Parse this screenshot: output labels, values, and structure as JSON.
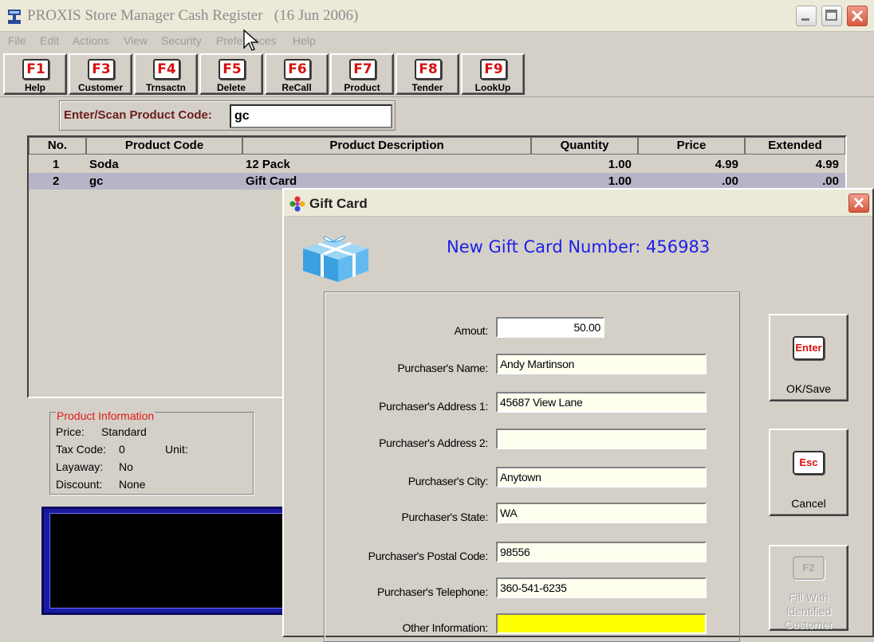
{
  "window": {
    "title": "PROXIS Store Manager Cash Register",
    "date": "(16 Jun 2006)",
    "app_icon": "register-icon",
    "buttons": [
      "minimize-icon",
      "maximize-icon",
      "close-icon"
    ]
  },
  "menu": [
    "File",
    "Edit",
    "Actions",
    "View",
    "Security",
    "Preferences",
    "Help"
  ],
  "toolbar": [
    {
      "key": "F1",
      "label": "Help"
    },
    {
      "key": "F3",
      "label": "Customer"
    },
    {
      "key": "F4",
      "label": "Trnsactn"
    },
    {
      "key": "F5",
      "label": "Delete"
    },
    {
      "key": "F6",
      "label": "ReCall"
    },
    {
      "key": "F7",
      "label": "Product"
    },
    {
      "key": "F8",
      "label": "Tender"
    },
    {
      "key": "F9",
      "label": "LookUp"
    }
  ],
  "scan": {
    "label": "Enter/Scan Product Code:",
    "value": "gc"
  },
  "grid": {
    "columns": [
      "No.",
      "Product Code",
      "Product Description",
      "Quantity",
      "Price",
      "Extended"
    ],
    "rows": [
      [
        "1",
        "Soda",
        "12 Pack",
        "1.00",
        "4.99",
        "4.99"
      ],
      [
        "2",
        "gc",
        "Gift Card",
        "1.00",
        ".00",
        ".00"
      ]
    ],
    "selected_row": 1
  },
  "product_info": {
    "legend": "Product Information",
    "price_label": "Price:",
    "price_value": "Standard",
    "tax_label": "Tax Code:",
    "tax_value": "0",
    "unit_label": "Unit:",
    "unit_value": "",
    "layaway_label": "Layaway:",
    "layaway_value": "No",
    "discount_label": "Discount:",
    "discount_value": "None"
  },
  "dialog": {
    "title": "Gift Card",
    "heading": "New Gift Card Number: 456983",
    "fields": [
      {
        "label": "Amout:",
        "value": "50.00"
      },
      {
        "label": "Purchaser's Name:",
        "value": "Andy Martinson"
      },
      {
        "label": "Purchaser's Address 1:",
        "value": "45687 View Lane"
      },
      {
        "label": "Purchaser's Address 2:",
        "value": ""
      },
      {
        "label": "Purchaser's City:",
        "value": "Anytown"
      },
      {
        "label": "Purchaser's State:",
        "value": "WA"
      },
      {
        "label": "Purchaser's Postal Code:",
        "value": "98556"
      },
      {
        "label": "Purchaser's Telephone:",
        "value": "360-541-6235"
      },
      {
        "label": "Other Information:",
        "value": ""
      }
    ],
    "ok": {
      "key": "Enter",
      "label": "OK/Save"
    },
    "cancel": {
      "key": "Esc",
      "label": "Cancel"
    },
    "fill": {
      "key": "F2",
      "label": "Fill With Identified Customer"
    }
  },
  "colors": {
    "heading_blue": "#1e1ee6",
    "legend_red": "#e21a1a",
    "other_info_yellow": "#ffff00",
    "selected_row": "#b8b4c8"
  }
}
